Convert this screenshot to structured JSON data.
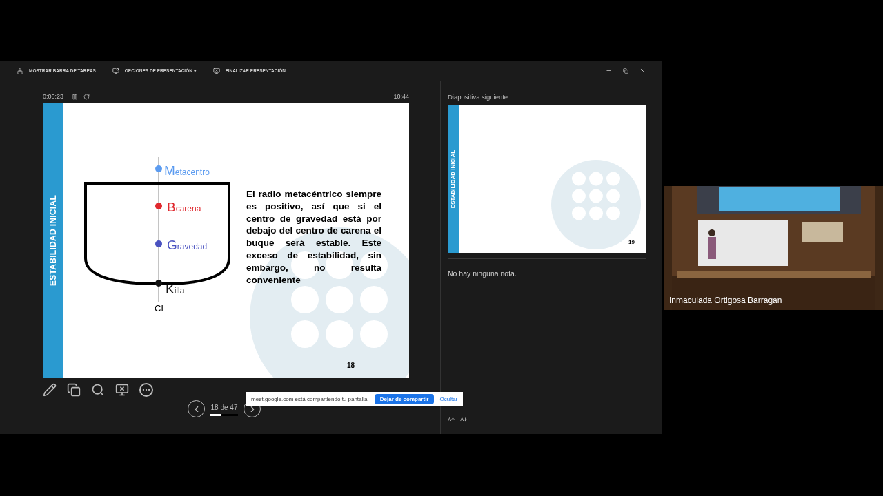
{
  "toolbar": {
    "items": [
      {
        "kind": "taskbar",
        "label": "MOSTRAR BARRA DE TAREAS"
      },
      {
        "kind": "options",
        "label": "OPCIONES DE PRESENTACIÓN ▾"
      },
      {
        "kind": "end",
        "label": "FINALIZAR PRESENTACIÓN"
      }
    ]
  },
  "timer": {
    "elapsed": "0:00:23",
    "clock": "10:44"
  },
  "current_slide": {
    "section": "ESTABILIDAD INICIAL",
    "number": "18",
    "points": [
      {
        "letter": "M",
        "label": "etacentro",
        "color": "#5b9bf0"
      },
      {
        "letter": "B",
        "label": "carena",
        "color": "#e0282e"
      },
      {
        "letter": "G",
        "label": "ravedad",
        "color": "#4a52c0"
      },
      {
        "letter": "K",
        "label": "illa",
        "color": "#111111"
      }
    ],
    "axis_label": "CL",
    "body": "El radio metacéntrico siempre es positivo, así que si el centro de gravedad está por debajo del centro de carena el buque será estable. Este exceso de estabilidad, sin embargo, no resulta conveniente"
  },
  "tools": [
    {
      "kind": "pen"
    },
    {
      "kind": "slides"
    },
    {
      "kind": "zoom"
    },
    {
      "kind": "screen"
    },
    {
      "kind": "more"
    }
  ],
  "navigation": {
    "counter": "18 de 47",
    "level": 0.38
  },
  "share_banner": {
    "message": "meet.google.com está compartiendo tu pantalla.",
    "stop": "Dejar de compartir",
    "hide": "Ocultar"
  },
  "next_slide": {
    "heading": "Diapositiva siguiente",
    "section": "ESTABILIDAD INICIAL",
    "number": "19"
  },
  "notes": {
    "text": "No hay ninguna nota."
  },
  "video": {
    "participant": "Inmaculada Ortigosa Barragan"
  }
}
